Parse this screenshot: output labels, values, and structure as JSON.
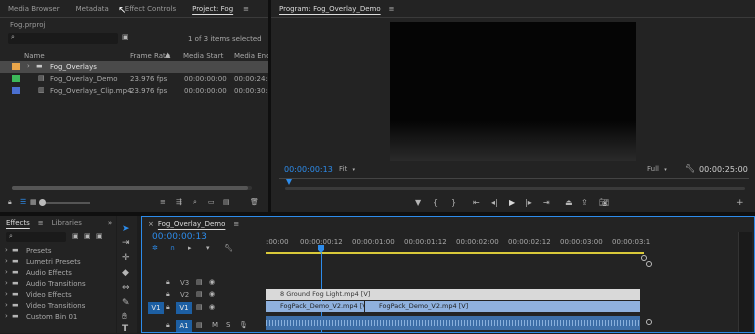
{
  "project_panel": {
    "tabs": [
      "Media Browser",
      "Metadata",
      "Effect Controls",
      "Project: Fog"
    ],
    "project_file": "Fog.prproj",
    "selection_status": "1 of 3 items selected",
    "columns": {
      "name": "Name",
      "frame_rate": "Frame Rate",
      "media_start": "Media Start",
      "media_end": "Media End"
    },
    "rows": [
      {
        "name": "Fog_Overlays",
        "frame_rate": "",
        "media_start": "",
        "media_end": "",
        "color": "#e9a54a",
        "selected": true
      },
      {
        "name": "Fog_Overlay_Demo",
        "frame_rate": "23.976 fps",
        "media_start": "00:00:00:00",
        "media_end": "00:00:24:",
        "color": "#3cb95a",
        "selected": false
      },
      {
        "name": "Fog_Overlays_Clip.mp4",
        "frame_rate": "23.976 fps",
        "media_start": "00:00:00:00",
        "media_end": "00:00:30:",
        "color": "#4a6fd0",
        "selected": false
      }
    ]
  },
  "program_monitor": {
    "title": "Program: Fog_Overlay_Demo",
    "current_time": "00:00:00:13",
    "fit": "Fit",
    "quality": "Full",
    "duration": "00:00:25:00"
  },
  "effects_panel": {
    "tabs": [
      "Effects",
      "Libraries"
    ],
    "items": [
      "Presets",
      "Lumetri Presets",
      "Audio Effects",
      "Audio Transitions",
      "Video Effects",
      "Video Transitions",
      "Custom Bin 01"
    ]
  },
  "timeline": {
    "tab": "Fog_Overlay_Demo",
    "timecode": "00:00:00:13",
    "ruler": [
      ":00:00",
      "00:00:00:12",
      "00:00:01:00",
      "00:00:01:12",
      "00:00:02:00",
      "00:00:02:12",
      "00:00:03:00",
      "00:00:03:1"
    ],
    "tracks": [
      {
        "src": "",
        "name": "V3"
      },
      {
        "src": "",
        "name": "V2"
      },
      {
        "src": "V1",
        "name": "V1"
      },
      {
        "src": "",
        "name": "A1"
      }
    ],
    "clips": {
      "v2": "8 Ground Fog Light.mp4 [V]",
      "v1a": "FogPack_Demo_V2.mp4 [V]",
      "v1b": "FogPack_Demo_V2.mp4 [V]"
    }
  },
  "colors": {
    "accent": "#2d8ceb",
    "bg": "#1d1d1d",
    "panel": "#232323"
  }
}
